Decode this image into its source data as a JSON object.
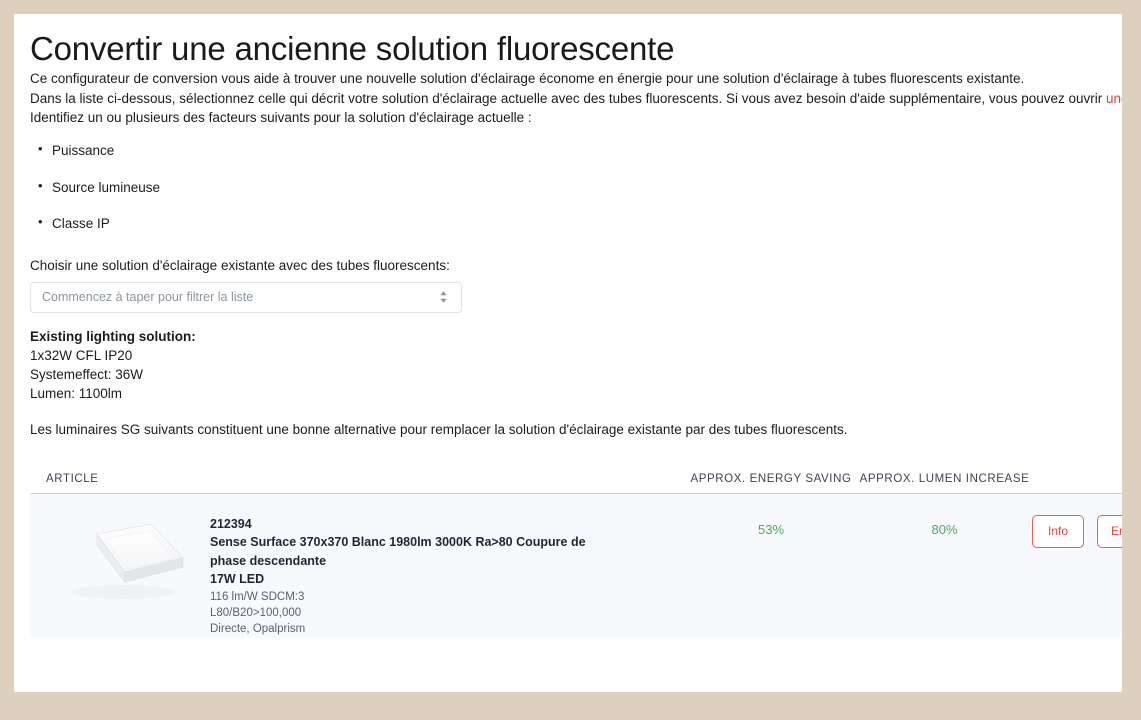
{
  "page": {
    "title": "Convertir une ancienne solution fluorescente",
    "background_color": "#ddd0be",
    "card_color": "#ffffff",
    "link_color": "#e8413c",
    "value_color": "#4aaa5e"
  },
  "intro": {
    "paragraph_1": "Ce configurateur de conversion vous aide à trouver une nouvelle solution d'éclairage économe en énergie pour une solution d'éclairage à tubes fluorescents existante.",
    "paragraph_2_before_link": "Dans la liste ci-dessous, sélectionnez celle qui décrit votre solution d'éclairage actuelle avec des tubes fluorescents. Si vous avez besoin d'aide supplémentaire, vous pouvez ouvrir ",
    "paragraph_2_link": "une vue d'ensemble ici",
    "paragraph_2_after_link": ".",
    "paragraph_3": "Identifiez un ou plusieurs des facteurs suivants pour la solution d'éclairage actuelle :"
  },
  "factors": [
    {
      "label": "Puissance"
    },
    {
      "label": "Source lumineuse"
    },
    {
      "label": "Classe IP"
    }
  ],
  "selector": {
    "label": "Choisir une solution d'éclairage existante avec des tubes fluorescents:",
    "placeholder": "Commencez à taper pour filtrer la liste",
    "value": ""
  },
  "existing_solution": {
    "heading": "Existing lighting solution:",
    "line_1": "1x32W CFL IP20",
    "line_2": "Systemeffect: 36W",
    "line_3": "Lumen: 1100lm"
  },
  "alternatives_intro": "Les luminaires SG suivants constituent une bonne alternative pour remplacer la solution d'éclairage existante par des tubes fluorescents.",
  "table": {
    "headers": {
      "article": "ARTICLE",
      "energy_saving": "APPROX. ENERGY SAVING",
      "lumen_increase": "APPROX. LUMEN INCREASE"
    },
    "rows": [
      {
        "sku": "212394",
        "name": "Sense Surface 370x370 Blanc 1980lm 3000K Ra>80 Coupure de phase descendante",
        "power": "17W LED",
        "spec_1": "116 lm/W SDCM:3",
        "spec_2": "L80/B20>100,000",
        "spec_3": "Directe, Opalprism",
        "energy_saving": "53%",
        "lumen_increase": "80%",
        "button_info": "Info",
        "button_second": "Enregistrer"
      }
    ]
  }
}
